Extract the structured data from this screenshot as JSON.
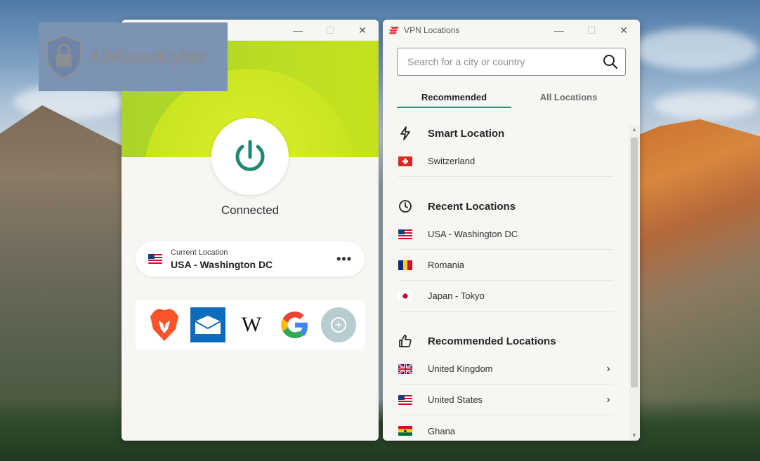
{
  "watermark": {
    "text": "AllAboutCyber"
  },
  "main_window": {
    "controls": {
      "minimize": "—",
      "maximize": "☐",
      "close": "✕"
    },
    "status": "Connected",
    "current_location": {
      "label": "Current Location",
      "value": "USA - Washington DC",
      "flag": "us"
    },
    "more_glyph": "•••",
    "shortcuts": [
      {
        "name": "brave-browser-shortcut",
        "icon": "brave-lion-icon"
      },
      {
        "name": "mail-shortcut",
        "icon": "mail-icon"
      },
      {
        "name": "wikipedia-shortcut",
        "icon": "wikipedia-icon",
        "glyph": "W"
      },
      {
        "name": "google-shortcut",
        "icon": "google-icon",
        "glyph": "G"
      },
      {
        "name": "add-shortcut",
        "icon": "plus-circle-icon",
        "glyph": "+"
      }
    ]
  },
  "locations_window": {
    "title": "VPN Locations",
    "controls": {
      "minimize": "—",
      "maximize": "☐",
      "close": "✕"
    },
    "search": {
      "placeholder": "Search for a city or country"
    },
    "tabs": [
      {
        "label": "Recommended",
        "active": true
      },
      {
        "label": "All Locations",
        "active": false
      }
    ],
    "sections": {
      "smart": {
        "title": "Smart Location",
        "items": [
          {
            "label": "Switzerland",
            "flag": "ch"
          }
        ]
      },
      "recent": {
        "title": "Recent Locations",
        "items": [
          {
            "label": "USA - Washington DC",
            "flag": "us"
          },
          {
            "label": "Romania",
            "flag": "ro"
          },
          {
            "label": "Japan - Tokyo",
            "flag": "jp"
          }
        ]
      },
      "recommended": {
        "title": "Recommended Locations",
        "items": [
          {
            "label": "United Kingdom",
            "flag": "gb",
            "expandable": true
          },
          {
            "label": "United States",
            "flag": "us",
            "expandable": true
          },
          {
            "label": "Ghana",
            "flag": "gh",
            "expandable": false
          }
        ]
      }
    },
    "chevron_glyph": "›"
  },
  "colors": {
    "accent_green": "#2e8b74",
    "hero_lime": "#c6e21e",
    "window_bg": "#f7f6f2",
    "watermark_bg": "#7c93b4"
  }
}
